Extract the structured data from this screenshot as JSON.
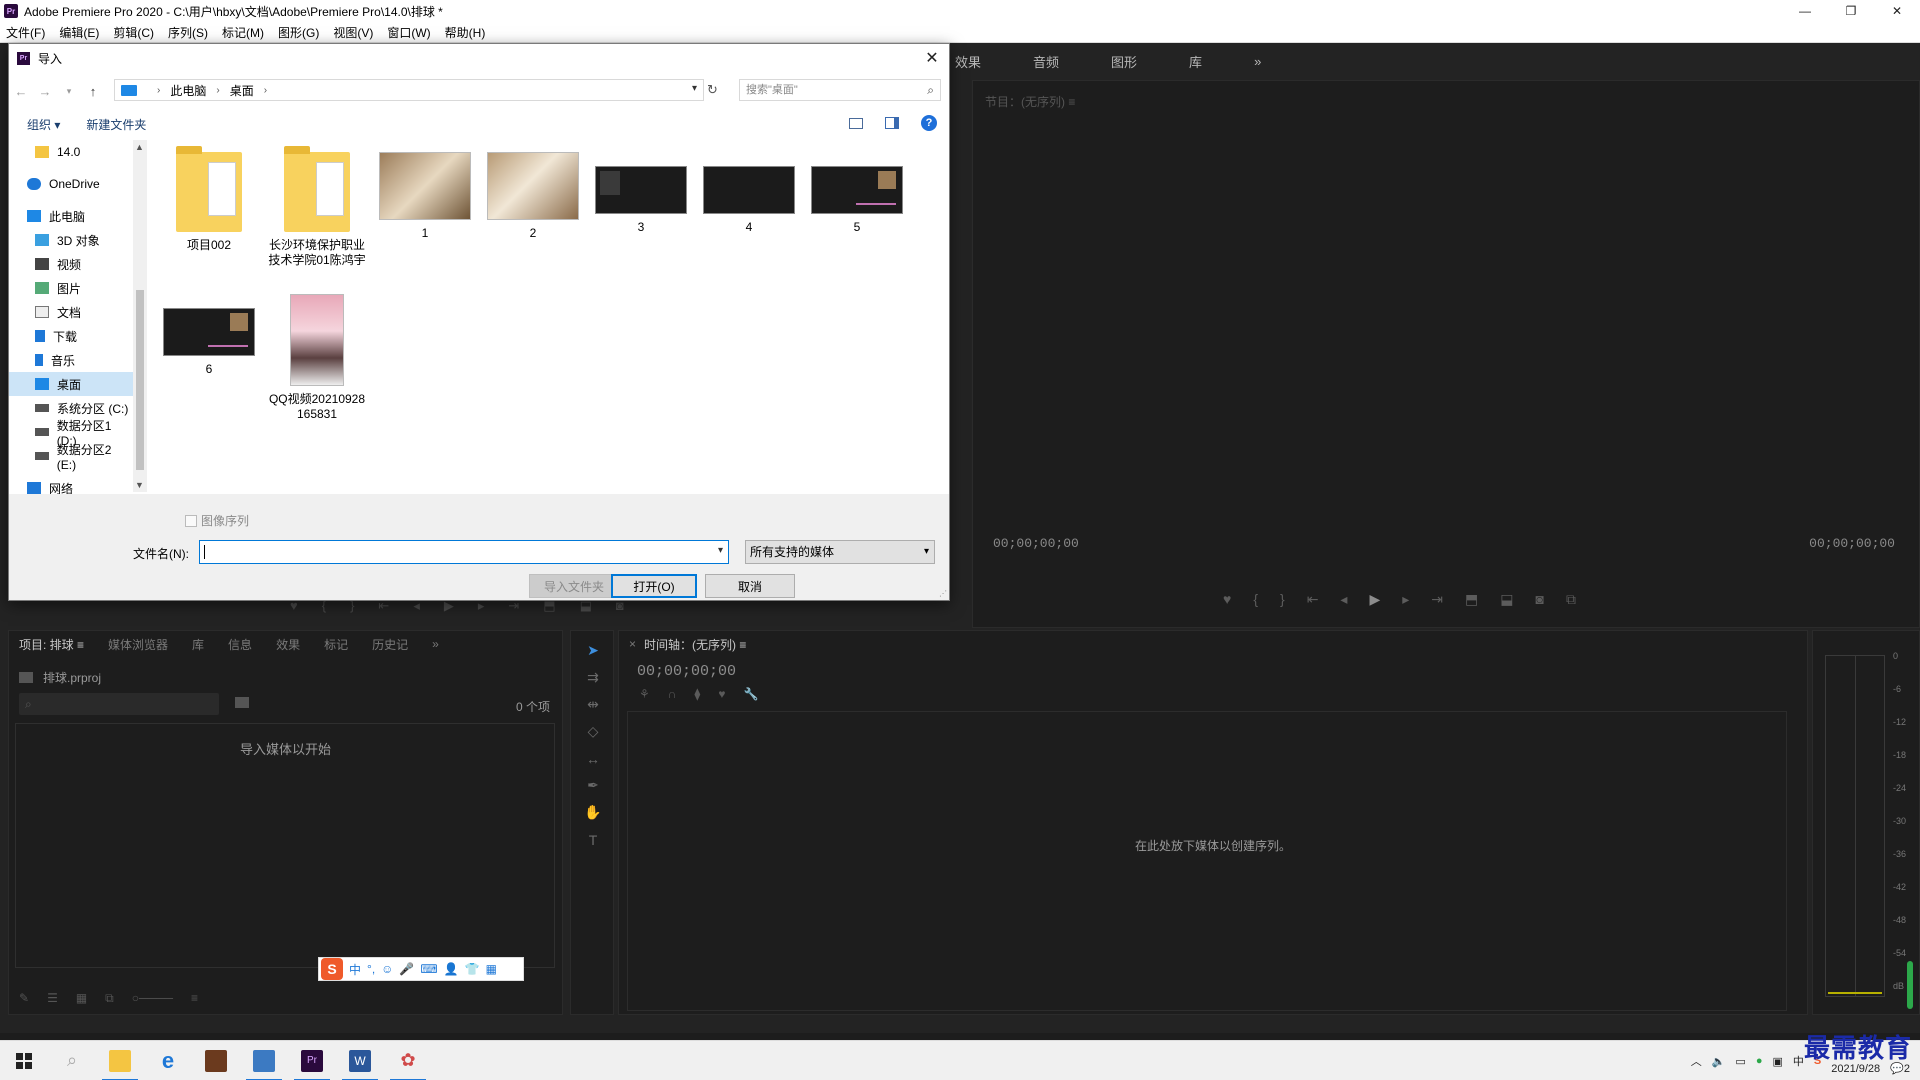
{
  "app": {
    "title": "Adobe Premiere Pro 2020 - C:\\用户\\hbxy\\文档\\Adobe\\Premiere Pro\\14.0\\排球 *",
    "logo": "Pr",
    "window_controls": [
      "—",
      "❐",
      "✕"
    ],
    "menu": [
      "文件(F)",
      "编辑(E)",
      "剪辑(C)",
      "序列(S)",
      "标记(M)",
      "图形(G)",
      "视图(V)",
      "窗口(W)",
      "帮助(H)"
    ]
  },
  "workspace_tabs": [
    "效果",
    "音频",
    "图形",
    "库",
    "»"
  ],
  "program_monitor": {
    "title": "节目：(无序列) ≡",
    "timecode_left": "00;00;00;00",
    "timecode_right": "00;00;00;00"
  },
  "project_panel": {
    "tabs": [
      "项目: 排球 ≡",
      "媒体浏览器",
      "库",
      "信息",
      "效果",
      "标记",
      "历史记",
      "»"
    ],
    "file": "排球.prproj",
    "items_count": "0 个项",
    "empty_text": "导入媒体以开始"
  },
  "timeline_panel": {
    "tab": "时间轴：(无序列) ≡",
    "timecode": "00;00;00;00",
    "empty_text": "在此处放下媒体以创建序列。"
  },
  "audio_meter": {
    "ticks": [
      "0",
      "-6",
      "-12",
      "-18",
      "-24",
      "-30",
      "-36",
      "-42",
      "-48",
      "-54",
      "dB"
    ]
  },
  "dialog": {
    "title": "导入",
    "close": "✕",
    "breadcrumb": [
      "此电脑",
      "桌面"
    ],
    "search_placeholder": "搜索\"桌面\"",
    "organize": "组织 ▾",
    "new_folder": "新建文件夹",
    "help": "?",
    "nav_tree": [
      {
        "label": "14.0",
        "icon": "folder-icon",
        "level": "child"
      },
      {
        "label": "OneDrive",
        "icon": "cloud-icon",
        "level": "top"
      },
      {
        "label": "此电脑",
        "icon": "pc-icon",
        "level": "top"
      },
      {
        "label": "3D 对象",
        "icon": "cube-icon",
        "level": "child"
      },
      {
        "label": "视频",
        "icon": "video-icon",
        "level": "child"
      },
      {
        "label": "图片",
        "icon": "picture-icon",
        "level": "child"
      },
      {
        "label": "文档",
        "icon": "document-icon",
        "level": "child"
      },
      {
        "label": "下载",
        "icon": "download-icon",
        "level": "child"
      },
      {
        "label": "音乐",
        "icon": "music-icon",
        "level": "child"
      },
      {
        "label": "桌面",
        "icon": "desktop-icon",
        "level": "child",
        "selected": true
      },
      {
        "label": "系统分区 (C:)",
        "icon": "drive-icon",
        "level": "child"
      },
      {
        "label": "数据分区1 (D:)",
        "icon": "drive-icon",
        "level": "child"
      },
      {
        "label": "数据分区2 (E:)",
        "icon": "drive-icon",
        "level": "child"
      },
      {
        "label": "网络",
        "icon": "network-icon",
        "level": "top"
      }
    ],
    "files": [
      {
        "name": "项目002",
        "kind": "folder"
      },
      {
        "name": "长沙环境保护职业技术学院01陈鸿宇",
        "kind": "folder"
      },
      {
        "name": "1",
        "kind": "photo"
      },
      {
        "name": "2",
        "kind": "photo"
      },
      {
        "name": "3",
        "kind": "screenshot"
      },
      {
        "name": "4",
        "kind": "screenshot"
      },
      {
        "name": "5",
        "kind": "screenshot"
      },
      {
        "name": "6",
        "kind": "screenshot"
      },
      {
        "name": "QQ视频20210928165831",
        "kind": "portrait"
      }
    ],
    "image_sequence_label": "图像序列",
    "filename_label": "文件名(N):",
    "filename_value": "",
    "filetype_value": "所有支持的媒体",
    "import_folder_button": "导入文件夹",
    "open_button": "打开(O)",
    "cancel_button": "取消"
  },
  "ime_bar": {
    "items": [
      "中",
      "°,",
      "☺",
      "🎤",
      "⌨",
      "👤",
      "👕",
      "▦"
    ]
  },
  "taskbar": {
    "clock_time": "",
    "clock_date": "2021/9/28",
    "notification_count": "2"
  },
  "watermark": "最需教育",
  "colors": {
    "accent": "#0078d7",
    "panel_bg": "#1d1d1d",
    "premiere_purple": "#2a0a3d"
  }
}
